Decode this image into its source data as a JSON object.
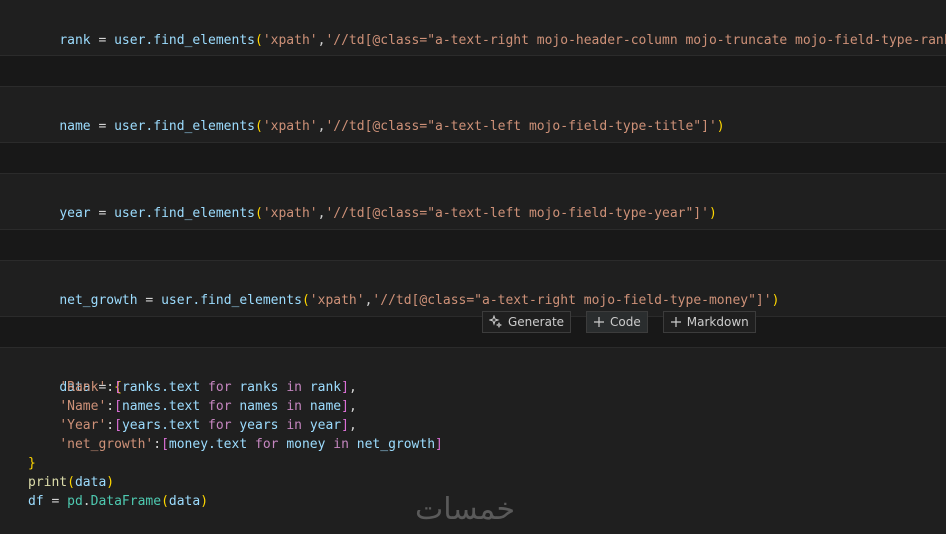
{
  "cells": [
    {
      "var": "rank",
      "call": "user.find_elements",
      "arg1": "'xpath'",
      "arg2": "'//td[@class=\"a-text-right mojo-header-column mojo-truncate mojo-field-type-rank\"]'"
    },
    {
      "var": "name",
      "call": "user.find_elements",
      "arg1": "'xpath'",
      "arg2": "'//td[@class=\"a-text-left mojo-field-type-title\"]'"
    },
    {
      "var": "year",
      "call": "user.find_elements",
      "arg1": "'xpath'",
      "arg2": "'//td[@class=\"a-text-left mojo-field-type-year\"]'"
    },
    {
      "var": "net_growth",
      "call": "user.find_elements",
      "arg1": "'xpath'",
      "arg2": "'//td[@class=\"a-text-right mojo-field-type-money\"]'"
    }
  ],
  "toolbar": {
    "generate_label": "Generate",
    "code_label": "Code",
    "markdown_label": "Markdown"
  },
  "last_cell": {
    "l1_var": "data",
    "l1_rest": " = ",
    "l2_key": "'Rank'",
    "l2_a": "ranks.text",
    "l2_for": "for",
    "l2_b": "ranks",
    "l2_in": "in",
    "l2_c": "rank",
    "l3_key": "'Name'",
    "l3_a": "names.text",
    "l3_for": "for",
    "l3_b": "names",
    "l3_in": "in",
    "l3_c": "name",
    "l4_key": "'Year'",
    "l4_a": "years.text",
    "l4_for": "for",
    "l4_b": "years",
    "l4_in": "in",
    "l4_c": "year",
    "l5_key": "'net_growth'",
    "l5_a": "money.text",
    "l5_for": "for",
    "l5_b": "money",
    "l5_in": "in",
    "l5_c": "net_growth",
    "l7_fn": "print",
    "l7_arg": "data",
    "l8_var": "df",
    "l8_mod": "pd",
    "l8_cls": "DataFrame",
    "l8_arg": "data"
  },
  "watermark": "خمسات"
}
